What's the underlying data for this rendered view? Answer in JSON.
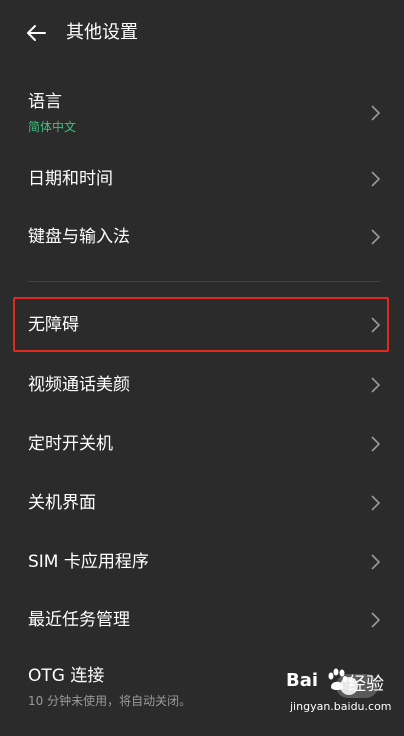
{
  "header": {
    "title": "其他设置"
  },
  "items": [
    {
      "label": "语言",
      "sub": "简体中文"
    },
    {
      "label": "日期和时间"
    },
    {
      "label": "键盘与输入法"
    },
    {
      "label": "无障碍"
    },
    {
      "label": "视频通话美颜"
    },
    {
      "label": "定时开关机"
    },
    {
      "label": "关机界面"
    },
    {
      "label": "SIM 卡应用程序"
    },
    {
      "label": "最近任务管理"
    },
    {
      "label": "OTG 连接",
      "sub": "10 分钟未使用，将自动关闭。"
    }
  ],
  "colors": {
    "background": "#2b2b2b",
    "accent_green": "#3fbf7f",
    "highlight_red": "#e0281e"
  },
  "watermark": {
    "brand": "Bai",
    "word": "经验",
    "url": "jingyan.baidu.com"
  }
}
